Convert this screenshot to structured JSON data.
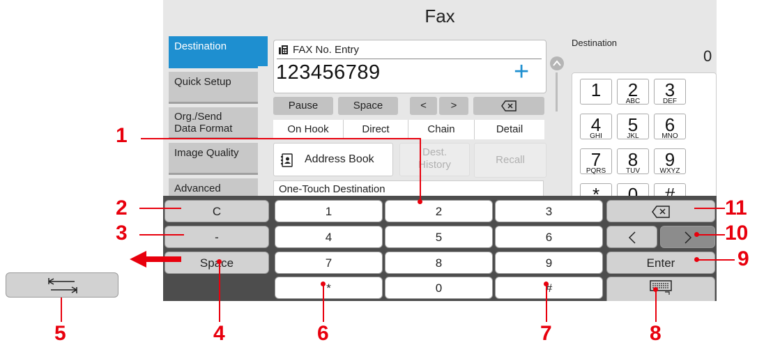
{
  "screen": {
    "title": "Fax",
    "tabs": [
      "Destination",
      "Quick Setup",
      "Org./Send\nData Format",
      "Image Quality",
      "Advanced"
    ],
    "entry_label": "FAX No. Entry",
    "fax_number": "123456789",
    "plus_symbol": "+",
    "small_buttons": [
      "Pause",
      "Space",
      "<",
      ">"
    ],
    "row_buttons": [
      "On Hook",
      "Direct",
      "Chain",
      "Detail"
    ],
    "address_book": "Address Book",
    "dest_history": "Dest.\nHistory",
    "recall": "Recall",
    "one_touch": "One-Touch Destination",
    "destination_label": "Destination",
    "destination_count": "0",
    "keypad": [
      {
        "d": "1",
        "l": ""
      },
      {
        "d": "2",
        "l": "ABC"
      },
      {
        "d": "3",
        "l": "DEF"
      },
      {
        "d": "4",
        "l": "GHI"
      },
      {
        "d": "5",
        "l": "JKL"
      },
      {
        "d": "6",
        "l": "MNO"
      },
      {
        "d": "7",
        "l": "PQRS"
      },
      {
        "d": "8",
        "l": "TUV"
      },
      {
        "d": "9",
        "l": "WXYZ"
      },
      {
        "d": "*",
        "l": ""
      },
      {
        "d": "0",
        "l": ""
      },
      {
        "d": "#",
        "l": ""
      }
    ]
  },
  "keyboard": {
    "row1": [
      "C",
      "1",
      "2",
      "3"
    ],
    "row2": [
      "-",
      "4",
      "5",
      "6"
    ],
    "row3": [
      "Space",
      "7",
      "8",
      "9",
      "Enter"
    ],
    "row4": [
      "*",
      "0",
      "#"
    ]
  },
  "callouts": [
    "1",
    "2",
    "3",
    "4",
    "5",
    "6",
    "7",
    "8",
    "9",
    "10",
    "11"
  ]
}
